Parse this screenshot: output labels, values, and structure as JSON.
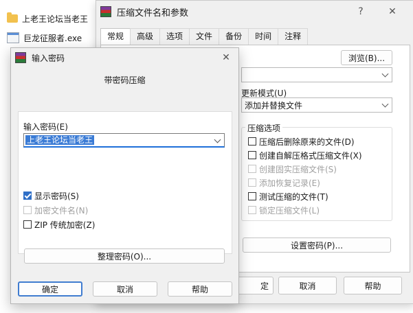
{
  "desktop": {
    "items": [
      {
        "label": "上老王论坛当老王",
        "icon": "folder-icon"
      },
      {
        "label": "巨龙征服者.exe",
        "icon": "exe-file-icon"
      }
    ]
  },
  "main_dialog": {
    "title": "压缩文件名和参数",
    "help_glyph": "?",
    "close_glyph": "✕",
    "tabs": [
      "常规",
      "高级",
      "选项",
      "文件",
      "备份",
      "时间",
      "注释"
    ],
    "browse_label": "浏览(B)...",
    "update_mode_label": "更新模式(U)",
    "update_mode_value": "添加并替换文件",
    "compress_options_label": "压缩选项",
    "options": [
      {
        "label": "压缩后删除原来的文件(D)",
        "checked": false,
        "disabled": false
      },
      {
        "label": "创建自解压格式压缩文件(X)",
        "checked": false,
        "disabled": false
      },
      {
        "label": "创建固实压缩文件(S)",
        "checked": false,
        "disabled": true
      },
      {
        "label": "添加恢复记录(E)",
        "checked": false,
        "disabled": true
      },
      {
        "label": "测试压缩的文件(T)",
        "checked": false,
        "disabled": false
      },
      {
        "label": "锁定压缩文件(L)",
        "checked": false,
        "disabled": true
      }
    ],
    "set_password_label": "设置密码(P)...",
    "ok_partial": "定",
    "cancel_label": "取消",
    "help_label": "帮助"
  },
  "password_dialog": {
    "title": "输入密码",
    "close_glyph": "✕",
    "heading": "带密码压缩",
    "field_label": "输入密码(E)",
    "field_value": "上老王论坛当老王",
    "checkboxes": [
      {
        "label": "显示密码(S)",
        "checked": true,
        "disabled": false
      },
      {
        "label": "加密文件名(N)",
        "checked": false,
        "disabled": true
      },
      {
        "label": "ZIP 传统加密(Z)",
        "checked": false,
        "disabled": false
      }
    ],
    "organize_label": "整理密码(O)...",
    "ok_label": "确定",
    "cancel_label": "取消",
    "help_label": "帮助"
  }
}
